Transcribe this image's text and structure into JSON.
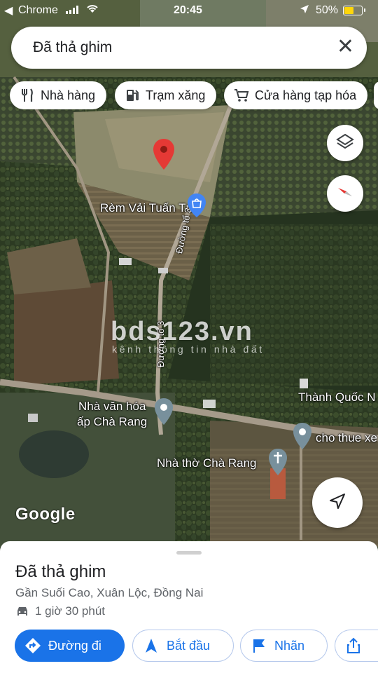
{
  "status_bar": {
    "back_glyph": "◀",
    "app": "Chrome",
    "time": "20:45",
    "battery": "50%",
    "battery_level": 0.5,
    "icons": [
      "signal-icon",
      "wifi-icon",
      "location-arrow-icon",
      "battery-icon"
    ]
  },
  "search": {
    "query": "Đã thả ghim",
    "close_icon": "close-icon"
  },
  "chips": [
    {
      "label": "Nhà hàng",
      "icon": "restaurant-icon"
    },
    {
      "label": "Trạm xăng",
      "icon": "gas-station-icon"
    },
    {
      "label": "Cửa hàng tạp hóa",
      "icon": "shopping-cart-icon"
    }
  ],
  "map": {
    "labels": {
      "shop": "Rèm Vải Tuấn Tú",
      "road_upper": "Đường tổ 3",
      "road_lower": "Đường tổ 3",
      "culture_house": "Nhà văn hóa",
      "culture_house_line2": "ấp Chà Rang",
      "church": "Nhà thờ Chà Rang",
      "thanh": "Thành Quốc N",
      "rental": "cho thue xe"
    },
    "watermark": "bds123.vn",
    "watermark_sub": "kênh thông tin nhà đất",
    "logo": "Google",
    "accent_pin": "#e53935",
    "accent_blue": "#1a73e8"
  },
  "sheet": {
    "title": "Đã thả ghim",
    "address": "Gần Suối Cao, Xuân Lộc, Đồng Nai",
    "drive_time": "1 giờ 30 phút",
    "buttons": [
      {
        "label": "Đường đi",
        "icon": "directions-icon"
      },
      {
        "label": "Bắt đầu",
        "icon": "navigation-arrow-icon"
      },
      {
        "label": "Nhãn",
        "icon": "flag-icon"
      },
      {
        "label": "",
        "icon": "share-icon"
      }
    ]
  }
}
